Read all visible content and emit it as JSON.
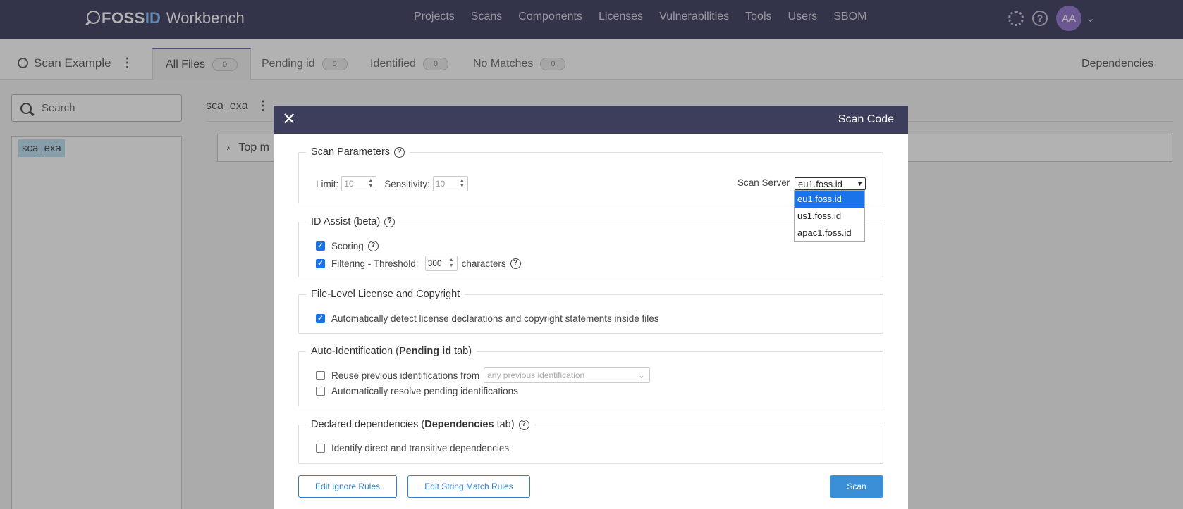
{
  "app": {
    "logo_foss": "FOSS",
    "logo_id": "ID",
    "logo_product": "Workbench"
  },
  "nav": {
    "links": [
      "Projects",
      "Scans",
      "Components",
      "Licenses",
      "Vulnerabilities",
      "Tools",
      "Users",
      "SBOM"
    ],
    "help": "?",
    "avatar": "AA"
  },
  "subnav": {
    "scan_name": "Scan Example",
    "tabs": [
      {
        "label": "All Files",
        "count": "0"
      },
      {
        "label": "Pending id",
        "count": "0"
      },
      {
        "label": "Identified",
        "count": "0"
      },
      {
        "label": "No Matches",
        "count": "0"
      }
    ],
    "dependencies": "Dependencies"
  },
  "sidebar": {
    "search_placeholder": "Search",
    "tree_item": "sca_exa"
  },
  "main": {
    "breadcrumb": "sca_exa",
    "panel_title": "Top m"
  },
  "modal": {
    "close": "✕",
    "title": "Scan Code",
    "scan_params": {
      "legend": "Scan Parameters",
      "limit_label": "Limit:",
      "limit_value": "10",
      "sensitivity_label": "Sensitivity:",
      "sensitivity_value": "10",
      "server_label": "Scan Server",
      "server_value": "eu1.foss.id",
      "server_options": [
        "eu1.foss.id",
        "us1.foss.id",
        "apac1.foss.id"
      ]
    },
    "id_assist": {
      "legend": "ID Assist (beta)",
      "scoring": "Scoring",
      "filtering": "Filtering - Threshold:",
      "threshold_value": "300",
      "characters": "characters"
    },
    "file_level": {
      "legend": "File-Level License and Copyright",
      "auto_detect": "Automatically detect license declarations and copyright statements inside files"
    },
    "auto_id": {
      "legend_prefix": "Auto-Identification (",
      "legend_bold": "Pending id",
      "legend_suffix": " tab)",
      "reuse": "Reuse previous identifications from",
      "reuse_select": "any previous identification",
      "resolve": "Automatically resolve pending identifications"
    },
    "declared": {
      "legend_prefix": "Declared dependencies (",
      "legend_bold": "Dependencies",
      "legend_suffix": " tab)",
      "identify": "Identify direct and transitive dependencies"
    },
    "buttons": {
      "edit_ignore": "Edit Ignore Rules",
      "edit_string": "Edit String Match Rules",
      "scan": "Scan"
    }
  }
}
